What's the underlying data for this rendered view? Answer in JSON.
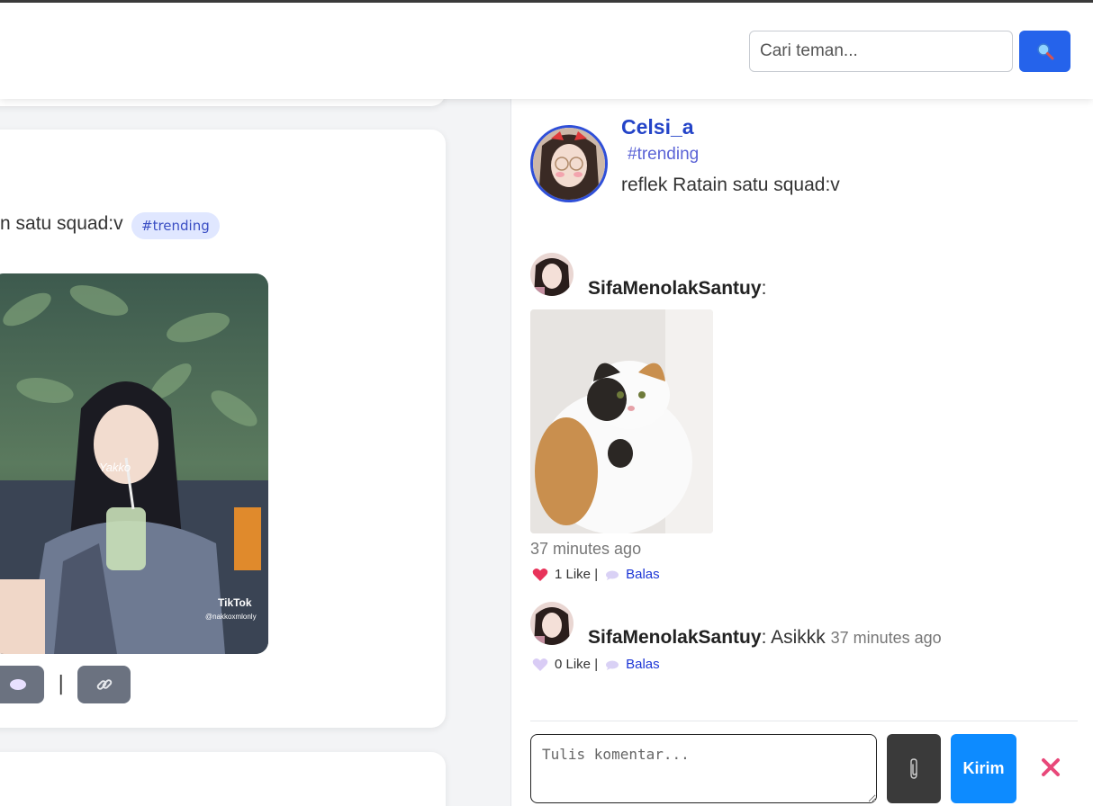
{
  "header": {
    "search_placeholder": "Cari teman..."
  },
  "feed": {
    "post_text": "n satu squad:v",
    "post_tag": "#trending",
    "image_watermark": "TikTok",
    "image_handle": "@nakkoxmlonly",
    "image_overlay_text": "Yakko",
    "separator": "|"
  },
  "panel": {
    "author": "Celsi_a",
    "tag": "#trending",
    "caption": "reflek Ratain satu squad:v",
    "comments": [
      {
        "user": "SifaMenolakSantuy",
        "colon": ":",
        "text": "",
        "time": "37 minutes ago",
        "likes": "1 Like |",
        "reply": "Balas",
        "liked": true
      },
      {
        "user": "SifaMenolakSantuy",
        "colon": ":",
        "text": " Asikkk",
        "time": "37 minutes ago",
        "likes": "0 Like |",
        "reply": "Balas",
        "liked": false
      }
    ],
    "comment_placeholder": "Tulis komentar...",
    "send_label": "Kirim"
  },
  "colors": {
    "primary": "#2563eb",
    "send": "#0d8bff",
    "author": "#2444c8",
    "heart_liked": "#e8335a",
    "heart_unliked": "#d9ccf5",
    "close": "#e8487a"
  }
}
